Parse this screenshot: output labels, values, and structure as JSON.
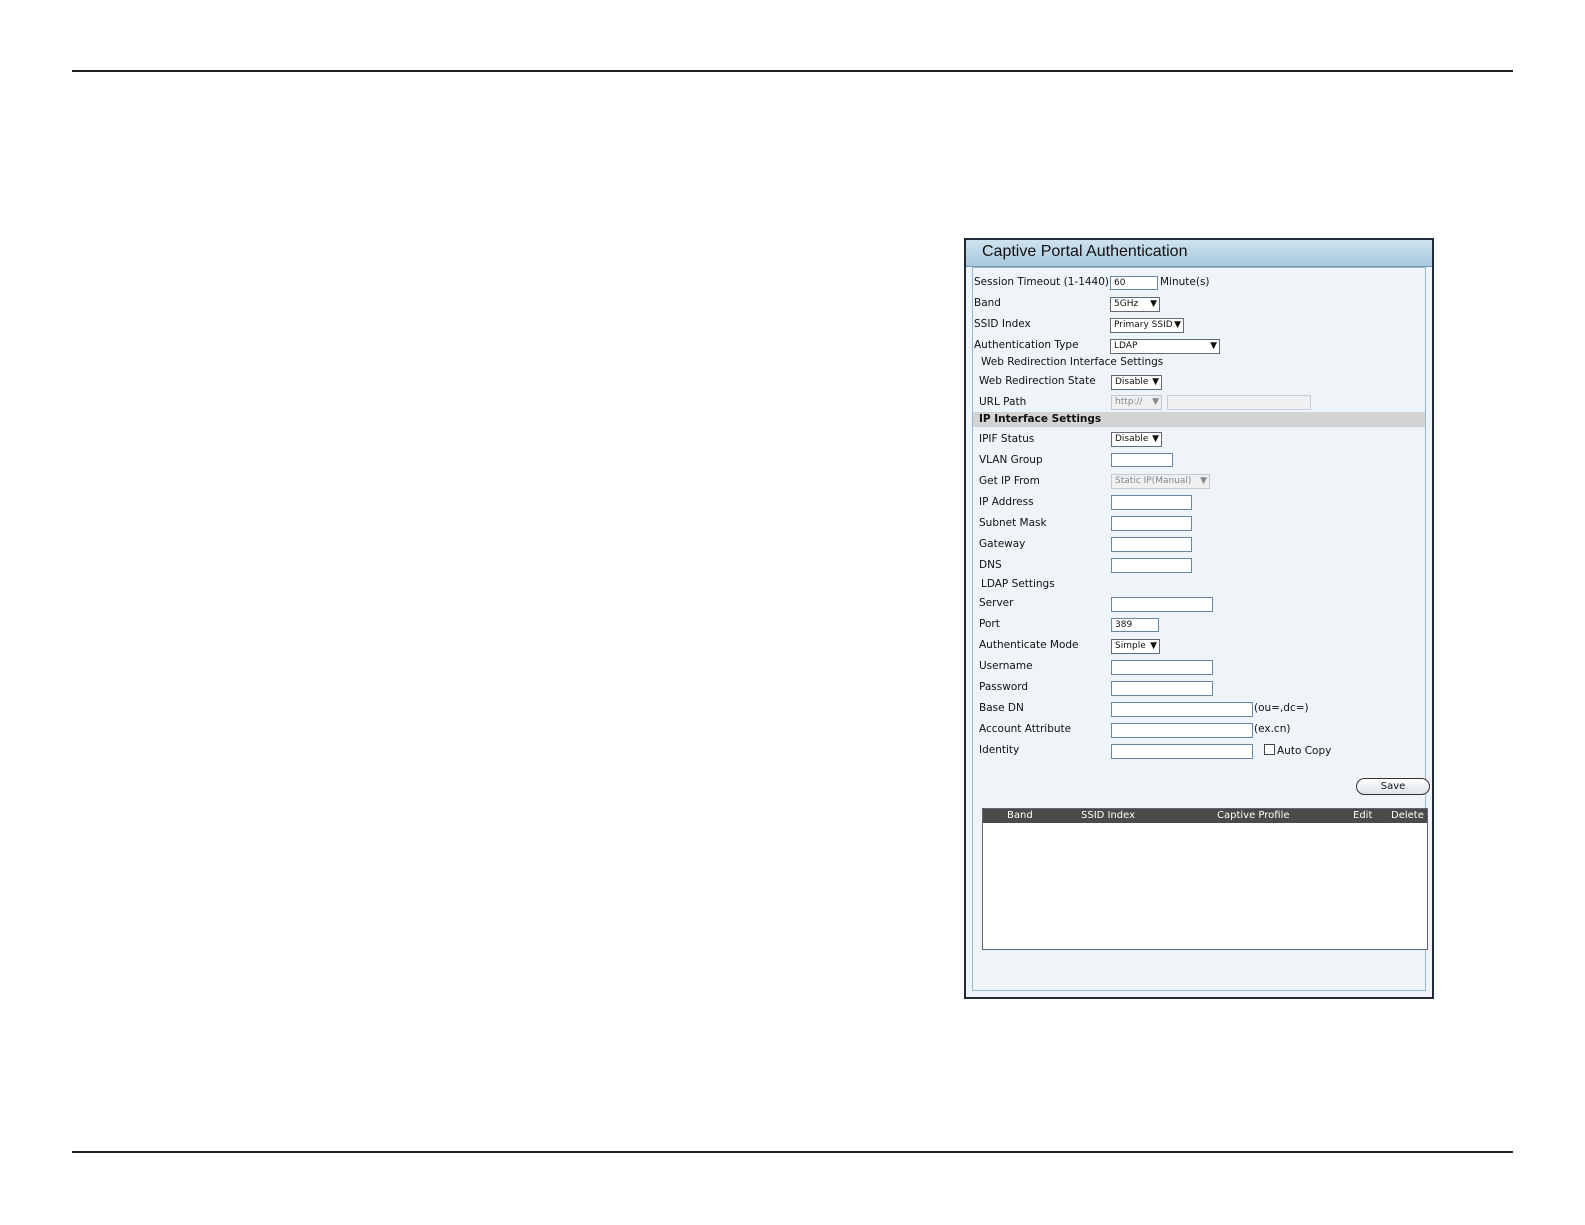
{
  "panel": {
    "title": "Captive Portal Authentication"
  },
  "form": {
    "session_timeout_label": "Session Timeout (1-1440)",
    "session_timeout_value": "60",
    "session_timeout_unit": "Minute(s)",
    "band_label": "Band",
    "band_value": "5GHz",
    "ssid_index_label": "SSID Index",
    "ssid_index_value": "Primary SSID",
    "auth_type_label": "Authentication Type",
    "auth_type_value": "LDAP",
    "web_redirection_section": "Web Redirection Interface Settings",
    "web_redirection_state_label": "Web Redirection State",
    "web_redirection_state_value": "Disable",
    "url_path_label": "URL Path",
    "url_path_scheme": "http://",
    "ip_interface_section": "IP Interface Settings",
    "ipif_status_label": "IPIF Status",
    "ipif_status_value": "Disable",
    "vlan_group_label": "VLAN Group",
    "get_ip_from_label": "Get IP From",
    "get_ip_from_value": "Static IP(Manual)",
    "ip_address_label": "IP Address",
    "subnet_mask_label": "Subnet Mask",
    "gateway_label": "Gateway",
    "dns_label": "DNS",
    "ldap_section": "LDAP Settings",
    "server_label": "Server",
    "port_label": "Port",
    "port_value": "389",
    "authenticate_mode_label": "Authenticate Mode",
    "authenticate_mode_value": "Simple",
    "username_label": "Username",
    "password_label": "Password",
    "base_dn_label": "Base DN",
    "base_dn_hint": "(ou=,dc=)",
    "account_attribute_label": "Account Attribute",
    "account_attribute_hint": "(ex.cn)",
    "identity_label": "Identity",
    "auto_copy_label": "Auto Copy",
    "save_label": "Save"
  },
  "table": {
    "columns": [
      "Band",
      "SSID Index",
      "Captive Profile",
      "Edit",
      "Delete"
    ]
  },
  "icons": {
    "dropdown": "chevron-down-icon",
    "checkbox": "checkbox-icon"
  }
}
